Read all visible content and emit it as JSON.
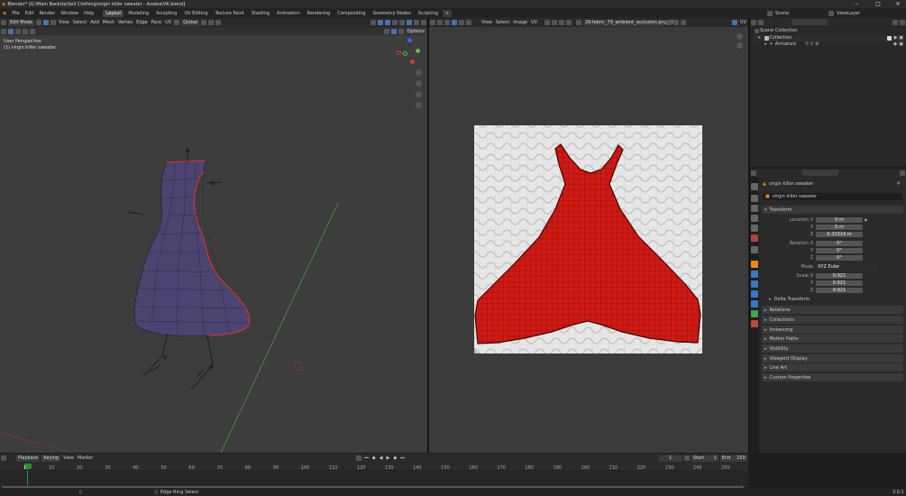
{
  "titlebar": {
    "title": "Blender* [G:\\Main BackUp\\Sell Clothing\\virgin killer sweater - Azalea\\VK.blend]",
    "min": "–",
    "max": "□",
    "close": "✕"
  },
  "menubar": {
    "menus": [
      "File",
      "Edit",
      "Render",
      "Window",
      "Help"
    ],
    "workspaces": [
      "Layout",
      "Modeling",
      "Sculpting",
      "UV Editing",
      "Texture Paint",
      "Shading",
      "Animation",
      "Rendering",
      "Compositing",
      "Geometry Nodes",
      "Scripting"
    ],
    "active_workspace": "Layout",
    "scene": "Scene",
    "view_layer": "ViewLayer"
  },
  "viewport": {
    "mode": "Edit Mode",
    "menus": [
      "View",
      "Select",
      "Add",
      "Mesh",
      "Vertex",
      "Edge",
      "Face",
      "UV"
    ],
    "orientation": "Global",
    "options": "Options",
    "overlay_line1": "User Perspective",
    "overlay_line2": "(1) virgin killer sweater"
  },
  "uv_editor": {
    "menus": [
      "View",
      "Select",
      "Image",
      "UV"
    ],
    "image_name": "2K-fabric_79_ambient_occlusion.png.003",
    "mode": "UV"
  },
  "outliner": {
    "scene_collection": "Scene Collection",
    "collection": "Collection",
    "armature": "Armature"
  },
  "properties": {
    "object_name": "virgin killer sweater",
    "object_field": "virgin killer sweater",
    "transform_label": "Transform",
    "location": [
      {
        "label": "Location X",
        "value": "0 m"
      },
      {
        "label": "Y",
        "value": "0 m"
      },
      {
        "label": "Z",
        "value": "0.22314 m"
      }
    ],
    "rotation": [
      {
        "label": "Rotation X",
        "value": "0°"
      },
      {
        "label": "Y",
        "value": "0°"
      },
      {
        "label": "Z",
        "value": "0°"
      }
    ],
    "mode_label": "Mode",
    "mode_value": "XYZ Euler",
    "scale": [
      {
        "label": "Scale X",
        "value": "0.921"
      },
      {
        "label": "Y",
        "value": "0.921"
      },
      {
        "label": "Z",
        "value": "0.921"
      }
    ],
    "delta": "Delta Transform",
    "panels": [
      "Relations",
      "Collections",
      "Instancing",
      "Motion Paths",
      "Visibility",
      "Viewport Display",
      "Line Art",
      "Custom Properties"
    ]
  },
  "timeline": {
    "menus": [
      "Playback",
      "Keying",
      "View",
      "Marker"
    ],
    "current_frame": "1",
    "start_label": "Start",
    "start": "1",
    "end_label": "End",
    "end": "250",
    "ticks": [
      "1",
      "10",
      "20",
      "30",
      "40",
      "50",
      "60",
      "70",
      "80",
      "90",
      "100",
      "110",
      "120",
      "130",
      "140",
      "150",
      "160",
      "170",
      "180",
      "190",
      "200",
      "210",
      "220",
      "230",
      "240",
      "250"
    ]
  },
  "statusbar": {
    "hint": "Edge Ring Select",
    "version": "3.0.1"
  },
  "colors": {
    "accent": "#4772b3",
    "mesh_fill": "#4b4470",
    "uv_edge": "#e8140f",
    "seam": "#ff2b2b",
    "timeline_current": "#2f8c2f"
  }
}
